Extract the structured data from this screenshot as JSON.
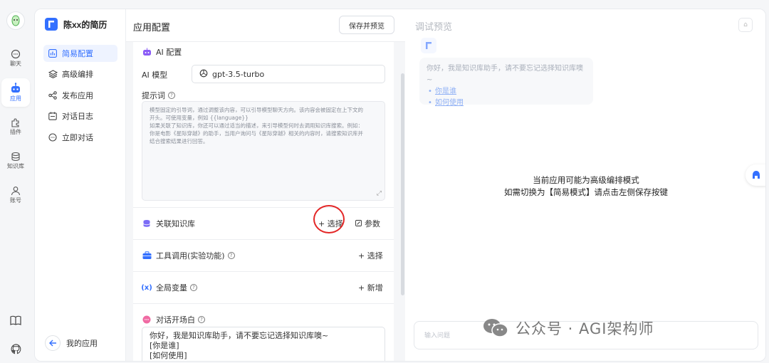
{
  "rail": {
    "items": [
      {
        "label": "聊天",
        "icon": "chat-icon"
      },
      {
        "label": "应用",
        "icon": "robot-icon"
      },
      {
        "label": "插件",
        "icon": "puzzle-icon"
      },
      {
        "label": "知识库",
        "icon": "database-icon"
      },
      {
        "label": "账号",
        "icon": "user-icon"
      }
    ],
    "bottom": [
      {
        "icon": "book-icon"
      },
      {
        "icon": "github-icon"
      }
    ]
  },
  "app": {
    "name": "陈xx的简历",
    "nav": [
      {
        "label": "简易配置",
        "icon": "chart-icon",
        "active": true
      },
      {
        "label": "高级编排",
        "icon": "layers-icon"
      },
      {
        "label": "发布应用",
        "icon": "share-icon"
      },
      {
        "label": "对话日志",
        "icon": "calendar-icon"
      },
      {
        "label": "立即对话",
        "icon": "chat-icon"
      }
    ],
    "back_label": "我的应用"
  },
  "config": {
    "title": "应用配置",
    "save_button": "保存并预览",
    "ai_section_title": "AI 配置",
    "model_label": "AI 模型",
    "model_value": "gpt-3.5-turbo",
    "prompt_label": "提示词",
    "prompt_lines": [
      "模型固定的引导词，通过调整该内容，可以引导模型聊天方向。该内容会被固定在上下文的",
      "开头。可使用变量，例如 {{language}}",
      "如果关联了知识库，你还可以通过适当的描述，来引导模型何时去调用知识库搜索。例如：",
      "你是电影《星际穿越》的助手，当用户询问与《星际穿越》相关的内容时，请搜索知识库并",
      "结合搜索结果进行回答。"
    ],
    "kb_section": {
      "title": "关联知识库",
      "select": "+ 选择",
      "params": "参数"
    },
    "tool_section": {
      "title": "工具调用(实验功能)",
      "select": "+ 选择"
    },
    "var_section": {
      "title": "全局变量",
      "add": "+ 新增"
    },
    "welcome_section": {
      "title": "对话开场白",
      "lines": [
        "你好，我是知识库助手，请不要忘记选择知识库噢~",
        "[你是谁]",
        "[如何使用]"
      ]
    }
  },
  "preview": {
    "title": "调试预览",
    "bubble_text": "你好，我是知识库助手，请不要忘记选择知识库噢~",
    "bubble_links": [
      "你是谁",
      "如何使用"
    ],
    "center_line1": "当前应用可能为高级编排模式",
    "center_line2": "如需切换为【简易模式】请点击左侧保存按键",
    "input_placeholder": "输入问题"
  },
  "watermark": "公众号 · AGI架构师",
  "colors": {
    "accent": "#3370ff",
    "highlight_circle": "#e32626"
  }
}
